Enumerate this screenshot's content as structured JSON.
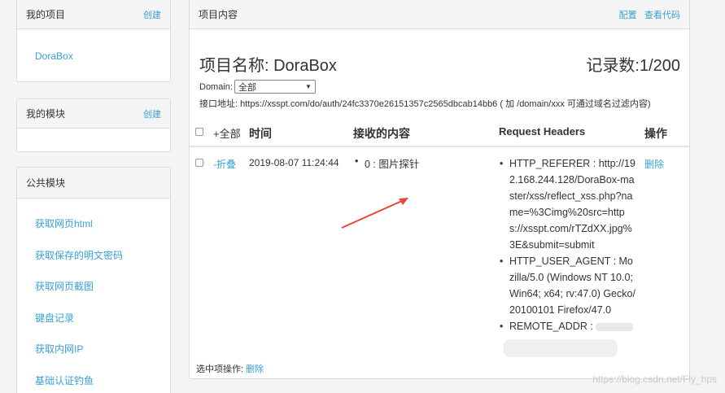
{
  "sidebar": {
    "projects": {
      "title": "我的项目",
      "action": "创建",
      "items": [
        "DoraBox"
      ]
    },
    "modules": {
      "title": "我的模块",
      "action": "创建"
    },
    "public": {
      "title": "公共模块",
      "items": [
        "获取网页html",
        "获取保存的明文密码",
        "获取网页截图",
        "键盘记录",
        "获取内网IP",
        "基础认证钓鱼"
      ]
    }
  },
  "main": {
    "header": {
      "title": "项目内容",
      "config": "配置",
      "view_code": "查看代码"
    },
    "project_name": "项目名称: DoraBox",
    "record_count": "记录数:1/200",
    "domain_label": "Domain:",
    "domain_value": "全部",
    "api_label": "接口地址: https://xsspt.com/do/auth/24fc3370e26151357c2565dbcab14bb6 ( 加 /domain/xxx 可通过域名过滤内容)",
    "table": {
      "col_all": "+全部",
      "col_time": "时间",
      "col_content": "接收的内容",
      "col_headers": "Request Headers",
      "col_action": "操作",
      "row": {
        "toggle": "-折叠",
        "time": "2019-08-07 11:24:44",
        "content": "0 : 图片探针",
        "headers": [
          "HTTP_REFERER : http://192.168.244.128/DoraBox-master/xss/reflect_xss.php?name=%3Cimg%20src=https://xsspt.com/rTZdXX.jpg%3E&submit=submit",
          "HTTP_USER_AGENT : Mozilla/5.0 (Windows NT 10.0; Win64; x64; rv:47.0) Gecko/20100101 Firefox/47.0",
          "REMOTE_ADDR :"
        ],
        "delete": "删除"
      }
    },
    "footer": {
      "label": "选中项操作:",
      "delete": "删除"
    }
  },
  "watermark": "https://blog.csdn.net/Fly_hps",
  "colors": {
    "link": "#3a9fd6",
    "arrow": "#e8463a"
  }
}
